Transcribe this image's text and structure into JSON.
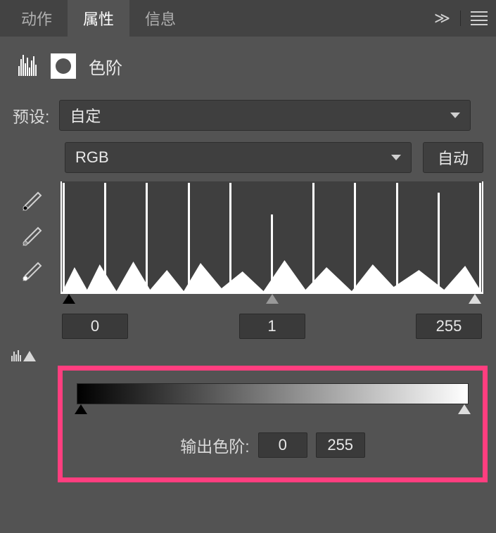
{
  "tabs": {
    "actions": "动作",
    "properties": "属性",
    "info": "信息"
  },
  "panel": {
    "title": "色阶",
    "preset_label": "预设:",
    "preset_value": "自定",
    "channel_value": "RGB",
    "auto_button": "自动"
  },
  "input_levels": {
    "black": "0",
    "gamma": "1",
    "white": "255"
  },
  "output": {
    "label": "输出色阶:",
    "black": "0",
    "white": "255"
  }
}
